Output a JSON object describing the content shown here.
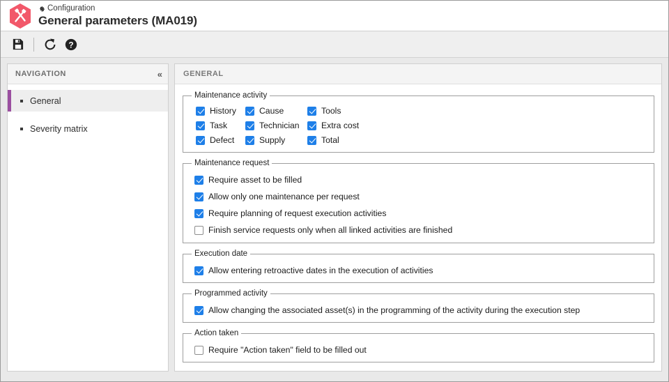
{
  "window": {
    "logo_icon": "hexagon-tools-icon",
    "logo_color": "#f2586a"
  },
  "header": {
    "breadcrumb_icon": "gear-icon",
    "breadcrumb": "Configuration",
    "title": "General parameters (MA019)"
  },
  "toolbar": {
    "buttons": [
      {
        "name": "save-button",
        "icon": "floppy-disk-icon",
        "label": "Save"
      },
      {
        "name": "refresh-button",
        "icon": "refresh-icon",
        "label": "Refresh"
      },
      {
        "name": "help-button",
        "icon": "question-circle-icon",
        "label": "Help"
      }
    ]
  },
  "sidebar": {
    "header_title": "NAVIGATION",
    "collapse_icon": "double-chevron-left-icon",
    "collapse_label": "«",
    "items": [
      {
        "label": "General",
        "active": true
      },
      {
        "label": "Severity matrix",
        "active": false
      }
    ]
  },
  "content": {
    "header_title": "GENERAL",
    "groups": [
      {
        "id": "maintenance-activity",
        "legend": "Maintenance activity",
        "layout": "grid3",
        "options": [
          {
            "label": "History",
            "checked": true
          },
          {
            "label": "Cause",
            "checked": true
          },
          {
            "label": "Tools",
            "checked": true
          },
          {
            "label": "Task",
            "checked": true
          },
          {
            "label": "Technician",
            "checked": true
          },
          {
            "label": "Extra cost",
            "checked": true
          },
          {
            "label": "Defect",
            "checked": true
          },
          {
            "label": "Supply",
            "checked": true
          },
          {
            "label": "Total",
            "checked": true
          }
        ]
      },
      {
        "id": "maintenance-request",
        "legend": "Maintenance request",
        "layout": "stack",
        "options": [
          {
            "label": "Require asset to be filled",
            "checked": true
          },
          {
            "label": "Allow only one maintenance per request",
            "checked": true
          },
          {
            "label": "Require planning of request execution activities",
            "checked": true
          },
          {
            "label": "Finish service requests only when all linked activities are finished",
            "checked": false
          }
        ]
      },
      {
        "id": "execution-date",
        "legend": "Execution date",
        "layout": "stack",
        "options": [
          {
            "label": "Allow entering retroactive dates in the execution of activities",
            "checked": true
          }
        ]
      },
      {
        "id": "programmed-activity",
        "legend": "Programmed activity",
        "layout": "stack",
        "options": [
          {
            "label": "Allow changing the associated asset(s) in the programming of the activity during the execution step",
            "checked": true
          }
        ]
      },
      {
        "id": "action-taken",
        "legend": "Action taken",
        "layout": "stack",
        "options": [
          {
            "label": "Require \"Action taken\" field to be filled out",
            "checked": false
          }
        ]
      }
    ]
  },
  "colors": {
    "accent_purple": "#9b4fa0",
    "checkbox_blue": "#1e7fe8",
    "logo_red": "#f2586a"
  }
}
